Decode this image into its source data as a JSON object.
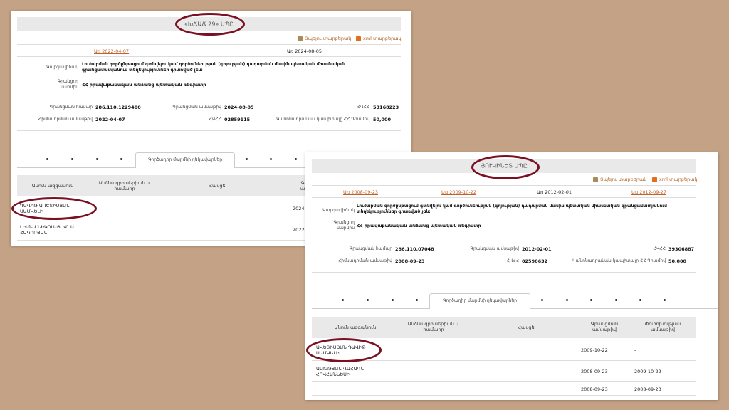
{
  "card1": {
    "title": "«ԽՃԱՃ 29» ՍՊԸ",
    "print_link": "Տպելու տարբերակ",
    "xml_link": "xml տարբերակ",
    "date_link": "Առ 2022-04-07",
    "date_current": "Առ 2024-08-05",
    "activity_label": "Կարգավիճակ",
    "activity_text": "Լուծարման գործընթացում գտնվելու կամ գործունեության (գոյության) դադարման մասին պետական միասնական գրանցամատյանում տեղեկություններ գրառված չեն։",
    "org_label_1": "Գրանցող",
    "org_label_2": "մարմին",
    "org_value": "ՀՀ իրավաբանական անձանց պետական ռեգիստր",
    "reg_no_label": "Գրանցման համար",
    "reg_no_value": "286.110.1229400",
    "reg_date_label": "Գրանցման ամսաթիվ",
    "reg_date_value": "2024-08-05",
    "tin_label": "ՀՎՀՀ",
    "tin_value": "53168223",
    "found_date_label": "Հիմնադրման ամսաթիվ",
    "found_date_value": "2022-04-07",
    "hvhh_label": "ՀՎՀՀ",
    "hvhh_value": "02859115",
    "capital_label": "Կանոնադրական կապիտալը ՀՀ Դրամով",
    "capital_value": "50,000",
    "tab_label": "Գործադիր մարմնի ղեկավարներ",
    "col_name": "Անուն ազգանուն",
    "col_passport_1": "Անձնագրի սերիան և",
    "col_passport_2": "համարը",
    "col_address": "Հասցե",
    "col_date_cut": "Գ",
    "col_date_cut2": "ա",
    "rows": [
      {
        "name_1": "ԴԱՎԻԹ ԱՎԵՏԻՍՅԱՆ",
        "name_2": "ՍԱՄՎԵԼԻ",
        "date": "2024-"
      },
      {
        "name_1": "ԼԻԱՆԱ ՆԻԿՈԼԱՅԵՎՆԱ",
        "name_2": "ՀԱԿՈԲՅԱՆ",
        "date": "2022-"
      }
    ]
  },
  "card2": {
    "title": "ՅՈՒԿԻՆԵՏ ՍՊԸ",
    "print_link": "Տպելու տարբերակ",
    "xml_link": "xml տարբերակ",
    "date_links": [
      "Առ 2008-09-23",
      "Առ 2009-10-22"
    ],
    "date_current": "Առ 2012-02-01",
    "date_link_last": "Առ 2012-09-27",
    "activity_label": "Կարգավիճակ",
    "activity_text": "Լուծարման գործընթացում գտնվելու կամ գործունեության (գոյության) դադարման մասին պետական միասնական գրանցամատյանում տեղեկություններ գրառված չեն։",
    "org_label_1": "Գրանցող",
    "org_label_2": "մարմին",
    "org_value": "ՀՀ իրավաբանական անձանց պետական ռեգիստր",
    "reg_no_label": "Գրանցման համար",
    "reg_no_value": "286.110.07048",
    "reg_date_label": "Գրանցման ամսաթիվ",
    "reg_date_value": "2012-02-01",
    "tin_label": "ՀՎՀՀ",
    "tin_value": "39306887",
    "found_date_label": "Հիմնադրման ամսաթիվ",
    "found_date_value": "2008-09-23",
    "hvhh_label": "ՀՎՀՀ",
    "hvhh_value": "02590632",
    "capital_label": "Կանոնադրական կապիտալը ՀՀ Դրամով",
    "capital_value": "50,000",
    "tab_label": "Գործադիր մարմնի ղեկավարներ",
    "col_name": "Անուն ազգանուն",
    "col_passport_1": "Անձնագրի սերիան և",
    "col_passport_2": "համարը",
    "col_address": "Հասցե",
    "col_date_1": "Գրանցման",
    "col_date_2": "ամսաթիվ",
    "col_change_1": "Փոփոխության",
    "col_change_2": "ամսաթիվ",
    "rows": [
      {
        "name_1": "ԱՎԵՏԻՍՅԱՆ ԴԱՎԻԹ",
        "name_2": "ՍԱՄՎԵԼԻ",
        "date": "2009-10-22",
        "change": "-"
      },
      {
        "name_1": "ԱԱԽԹՅԱՆ ՎԱՀԱԳՆ",
        "name_2": "ՀՈՎՀԱՆՆԵՍԻ",
        "date": "2008-09-23",
        "change": "2009-10-22"
      },
      {
        "name_1": "",
        "name_2": "",
        "date": "2008-09-23",
        "change": "2008-09-23"
      }
    ]
  },
  "colors": {
    "background": "#c4a285",
    "highlight_ring": "#7a1123",
    "link": "#c0622a"
  },
  "icons": {
    "print": "printer-icon",
    "xml": "xml-file-icon"
  }
}
